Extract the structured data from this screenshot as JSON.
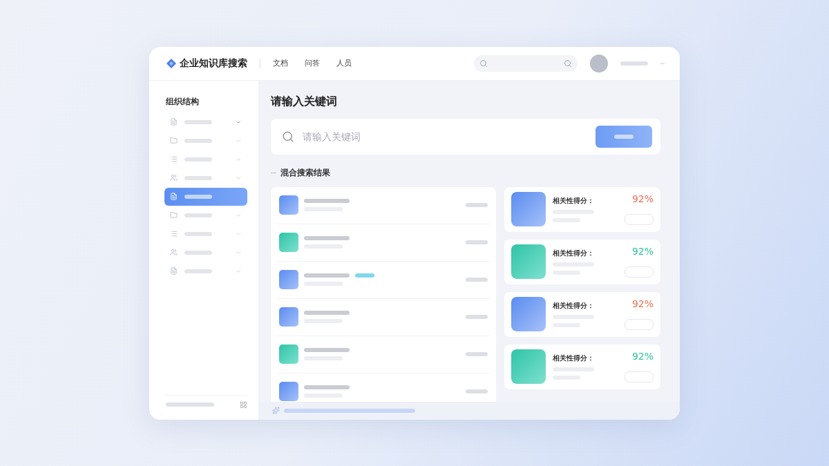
{
  "header": {
    "logo": "企业知识库搜索",
    "nav": [
      "文档",
      "问答",
      "人员"
    ]
  },
  "sidebar": {
    "title": "组织结构",
    "items": [
      {
        "selected": false
      },
      {
        "selected": false
      },
      {
        "selected": false
      },
      {
        "selected": false
      },
      {
        "selected": true
      },
      {
        "selected": false
      },
      {
        "selected": false
      },
      {
        "selected": false
      },
      {
        "selected": false
      }
    ]
  },
  "main": {
    "title": "请输入关键词",
    "search": {
      "placeholder": "请输入关键词"
    },
    "section_title": "混合搜索结果",
    "list": [
      {
        "kind": "blue",
        "tag": false
      },
      {
        "kind": "teal",
        "tag": false
      },
      {
        "kind": "blue",
        "tag": true
      },
      {
        "kind": "blue",
        "tag": false
      },
      {
        "kind": "teal",
        "tag": false
      },
      {
        "kind": "blue",
        "tag": false
      }
    ],
    "cards": [
      {
        "kind": "blue",
        "title": "相关性得分：",
        "score": "92%",
        "color": "#e8704f"
      },
      {
        "kind": "teal",
        "title": "相关性得分：",
        "score": "92%",
        "color": "#2fc49a"
      },
      {
        "kind": "blue",
        "title": "相关性得分：",
        "score": "92%",
        "color": "#e8704f"
      },
      {
        "kind": "teal",
        "title": "相关性得分：",
        "score": "92%",
        "color": "#2fc49a"
      }
    ]
  }
}
